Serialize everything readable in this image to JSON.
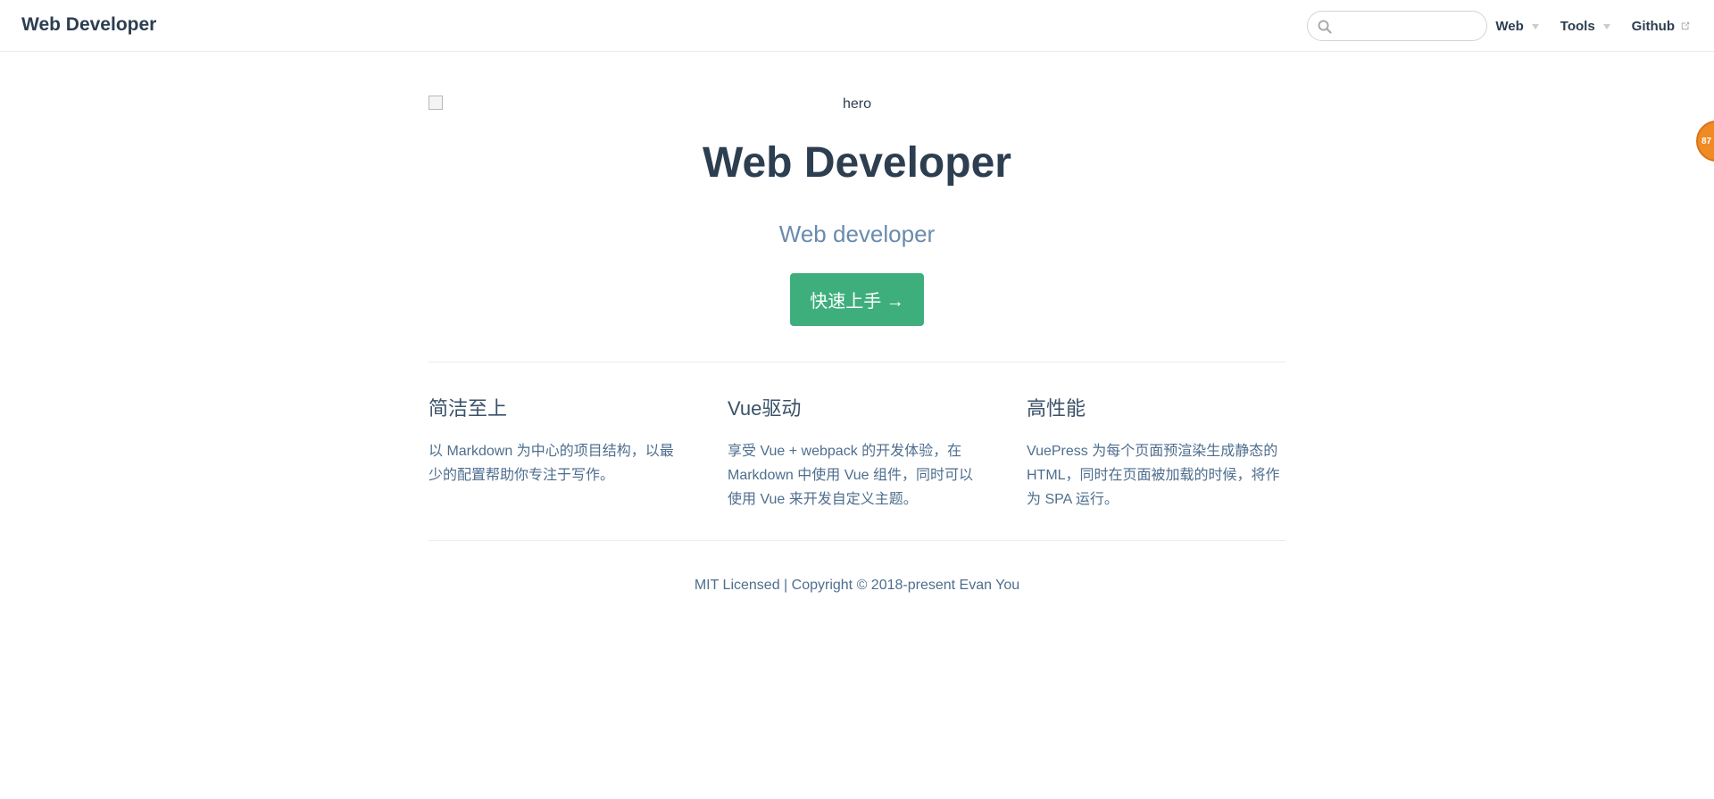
{
  "navbar": {
    "site_name": "Web Developer",
    "search": {
      "value": "",
      "placeholder": ""
    },
    "items": [
      {
        "label": "Web",
        "type": "dropdown"
      },
      {
        "label": "Tools",
        "type": "dropdown"
      },
      {
        "label": "Github",
        "type": "external-link"
      }
    ]
  },
  "floating_badge": {
    "text": "87"
  },
  "hero": {
    "image_alt": "hero",
    "title": "Web Developer",
    "description": "Web developer",
    "action_label": "快速上手 →"
  },
  "features": [
    {
      "title": "简洁至上",
      "details": "以 Markdown 为中心的项目结构，以最少的配置帮助你专注于写作。"
    },
    {
      "title": "Vue驱动",
      "details": "享受 Vue + webpack 的开发体验，在 Markdown 中使用 Vue 组件，同时可以使用 Vue 来开发自定义主题。"
    },
    {
      "title": "高性能",
      "details": "VuePress 为每个页面预渲染生成静态的 HTML，同时在页面被加载的时候，将作为 SPA 运行。"
    }
  ],
  "footer": {
    "text": "MIT Licensed | Copyright © 2018-present Evan You"
  },
  "colors": {
    "accent": "#3eaf7c",
    "text": "#2c3e50",
    "muted": "#6a8bad",
    "badge": "#f08a24"
  }
}
